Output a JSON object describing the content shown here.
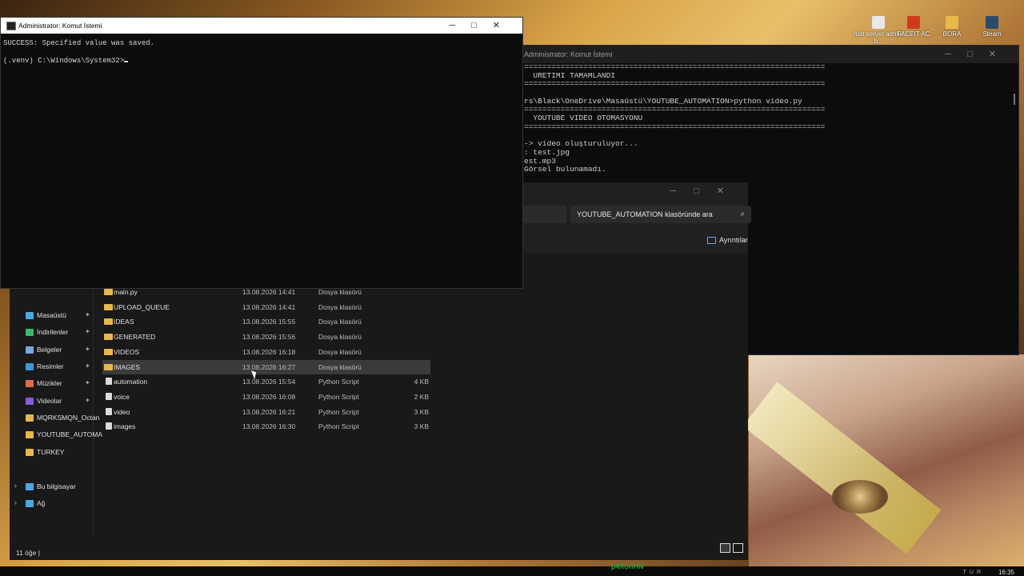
{
  "desktop": {
    "icons": [
      {
        "label": "rust server admin b...",
        "icon": "file-icon",
        "color": "#e8e8e8"
      },
      {
        "label": "FACEIT AC",
        "icon": "faceit-icon",
        "color": "#d23a1e"
      },
      {
        "label": "BORA",
        "icon": "folder-icon",
        "color": "#e8b84a"
      },
      {
        "label": "Steam",
        "icon": "steam-icon",
        "color": "#2b4a6e"
      }
    ],
    "watermark": "p4XonHN"
  },
  "cmd_back": {
    "title": "Administrator: Komut İstemi",
    "lines": [
      "==================================================================",
      "  URETIMI TAMAMLANDI",
      "==================================================================",
      "",
      "rs\\Black\\OneDrive\\Masaüstü\\YOUTUBE_AUTOMATION>python video.py",
      "==================================================================",
      "  YOUTUBE VIDEO OTOMASYONU",
      "==================================================================",
      "",
      "-> video oluşturuluyor...",
      ": test.jpg",
      "est.mp3",
      "Görsel bulunamadı."
    ]
  },
  "cmd_front": {
    "title": "Administrator: Komut İstemi",
    "lines": [
      "SUCCESS: Specified value was saved.",
      "(.venv) C:\\Windows\\System32>"
    ]
  },
  "explorer": {
    "search_placeholder": "YOUTUBE_AUTOMATION klasöründe ara",
    "details_label": "Ayrıntılar",
    "nav": [
      {
        "label": "Masaüstü",
        "icon": "desktop-icon",
        "color": "#4aa8e8",
        "pinned": true
      },
      {
        "label": "İndirilenler",
        "icon": "download-icon",
        "color": "#3ab86a",
        "pinned": true
      },
      {
        "label": "Belgeler",
        "icon": "documents-icon",
        "color": "#7aa8e0",
        "pinned": true
      },
      {
        "label": "Resimler",
        "icon": "pictures-icon",
        "color": "#3a9ad8",
        "pinned": true
      },
      {
        "label": "Müzikler",
        "icon": "music-icon",
        "color": "#e06a4a",
        "pinned": true
      },
      {
        "label": "Videolar",
        "icon": "videos-icon",
        "color": "#8a5ae0",
        "pinned": true
      },
      {
        "label": "MQRKSMQN_Octan",
        "icon": "folder-icon",
        "color": "#e8b84a",
        "pinned": false
      },
      {
        "label": "YOUTUBE_AUTOMA",
        "icon": "folder-icon",
        "color": "#e8b84a",
        "pinned": false
      },
      {
        "label": "TURKEY",
        "icon": "folder-icon",
        "color": "#e8b84a",
        "pinned": false
      }
    ],
    "nav_bottom": [
      {
        "label": "Bu bilgisayar",
        "icon": "computer-icon",
        "color": "#4aa8e8"
      },
      {
        "label": "Ağ",
        "icon": "network-icon",
        "color": "#4aa8e8"
      }
    ],
    "files": [
      {
        "name": "main.py",
        "date": "13.08.2026 14:41",
        "type": "Dosya klasörü",
        "size": "",
        "kind": "folder"
      },
      {
        "name": "UPLOAD_QUEUE",
        "date": "13.08.2026 14:41",
        "type": "Dosya klasörü",
        "size": "",
        "kind": "folder"
      },
      {
        "name": "IDEAS",
        "date": "13.08.2026 15:55",
        "type": "Dosya klasörü",
        "size": "",
        "kind": "folder"
      },
      {
        "name": "GENERATED",
        "date": "13.08.2026 15:56",
        "type": "Dosya klasörü",
        "size": "",
        "kind": "folder"
      },
      {
        "name": "VIDEOS",
        "date": "13.08.2026 16:18",
        "type": "Dosya klasörü",
        "size": "",
        "kind": "folder"
      },
      {
        "name": "IMAGES",
        "date": "13.08.2026 16:27",
        "type": "Dosya klasörü",
        "size": "",
        "kind": "folder",
        "selected": true
      },
      {
        "name": "automation",
        "date": "13.08.2026 15:54",
        "type": "Python Script",
        "size": "4 KB",
        "kind": "py"
      },
      {
        "name": "voice",
        "date": "13.08.2026 16:08",
        "type": "Python Script",
        "size": "2 KB",
        "kind": "py"
      },
      {
        "name": "video",
        "date": "13.08.2026 16:21",
        "type": "Python Script",
        "size": "3 KB",
        "kind": "py"
      },
      {
        "name": "images",
        "date": "13.08.2026 16:30",
        "type": "Python Script",
        "size": "3 KB",
        "kind": "py"
      }
    ],
    "status": "11 öğe"
  },
  "taskbar": {
    "clock": "16:35",
    "tray": "TUR"
  }
}
